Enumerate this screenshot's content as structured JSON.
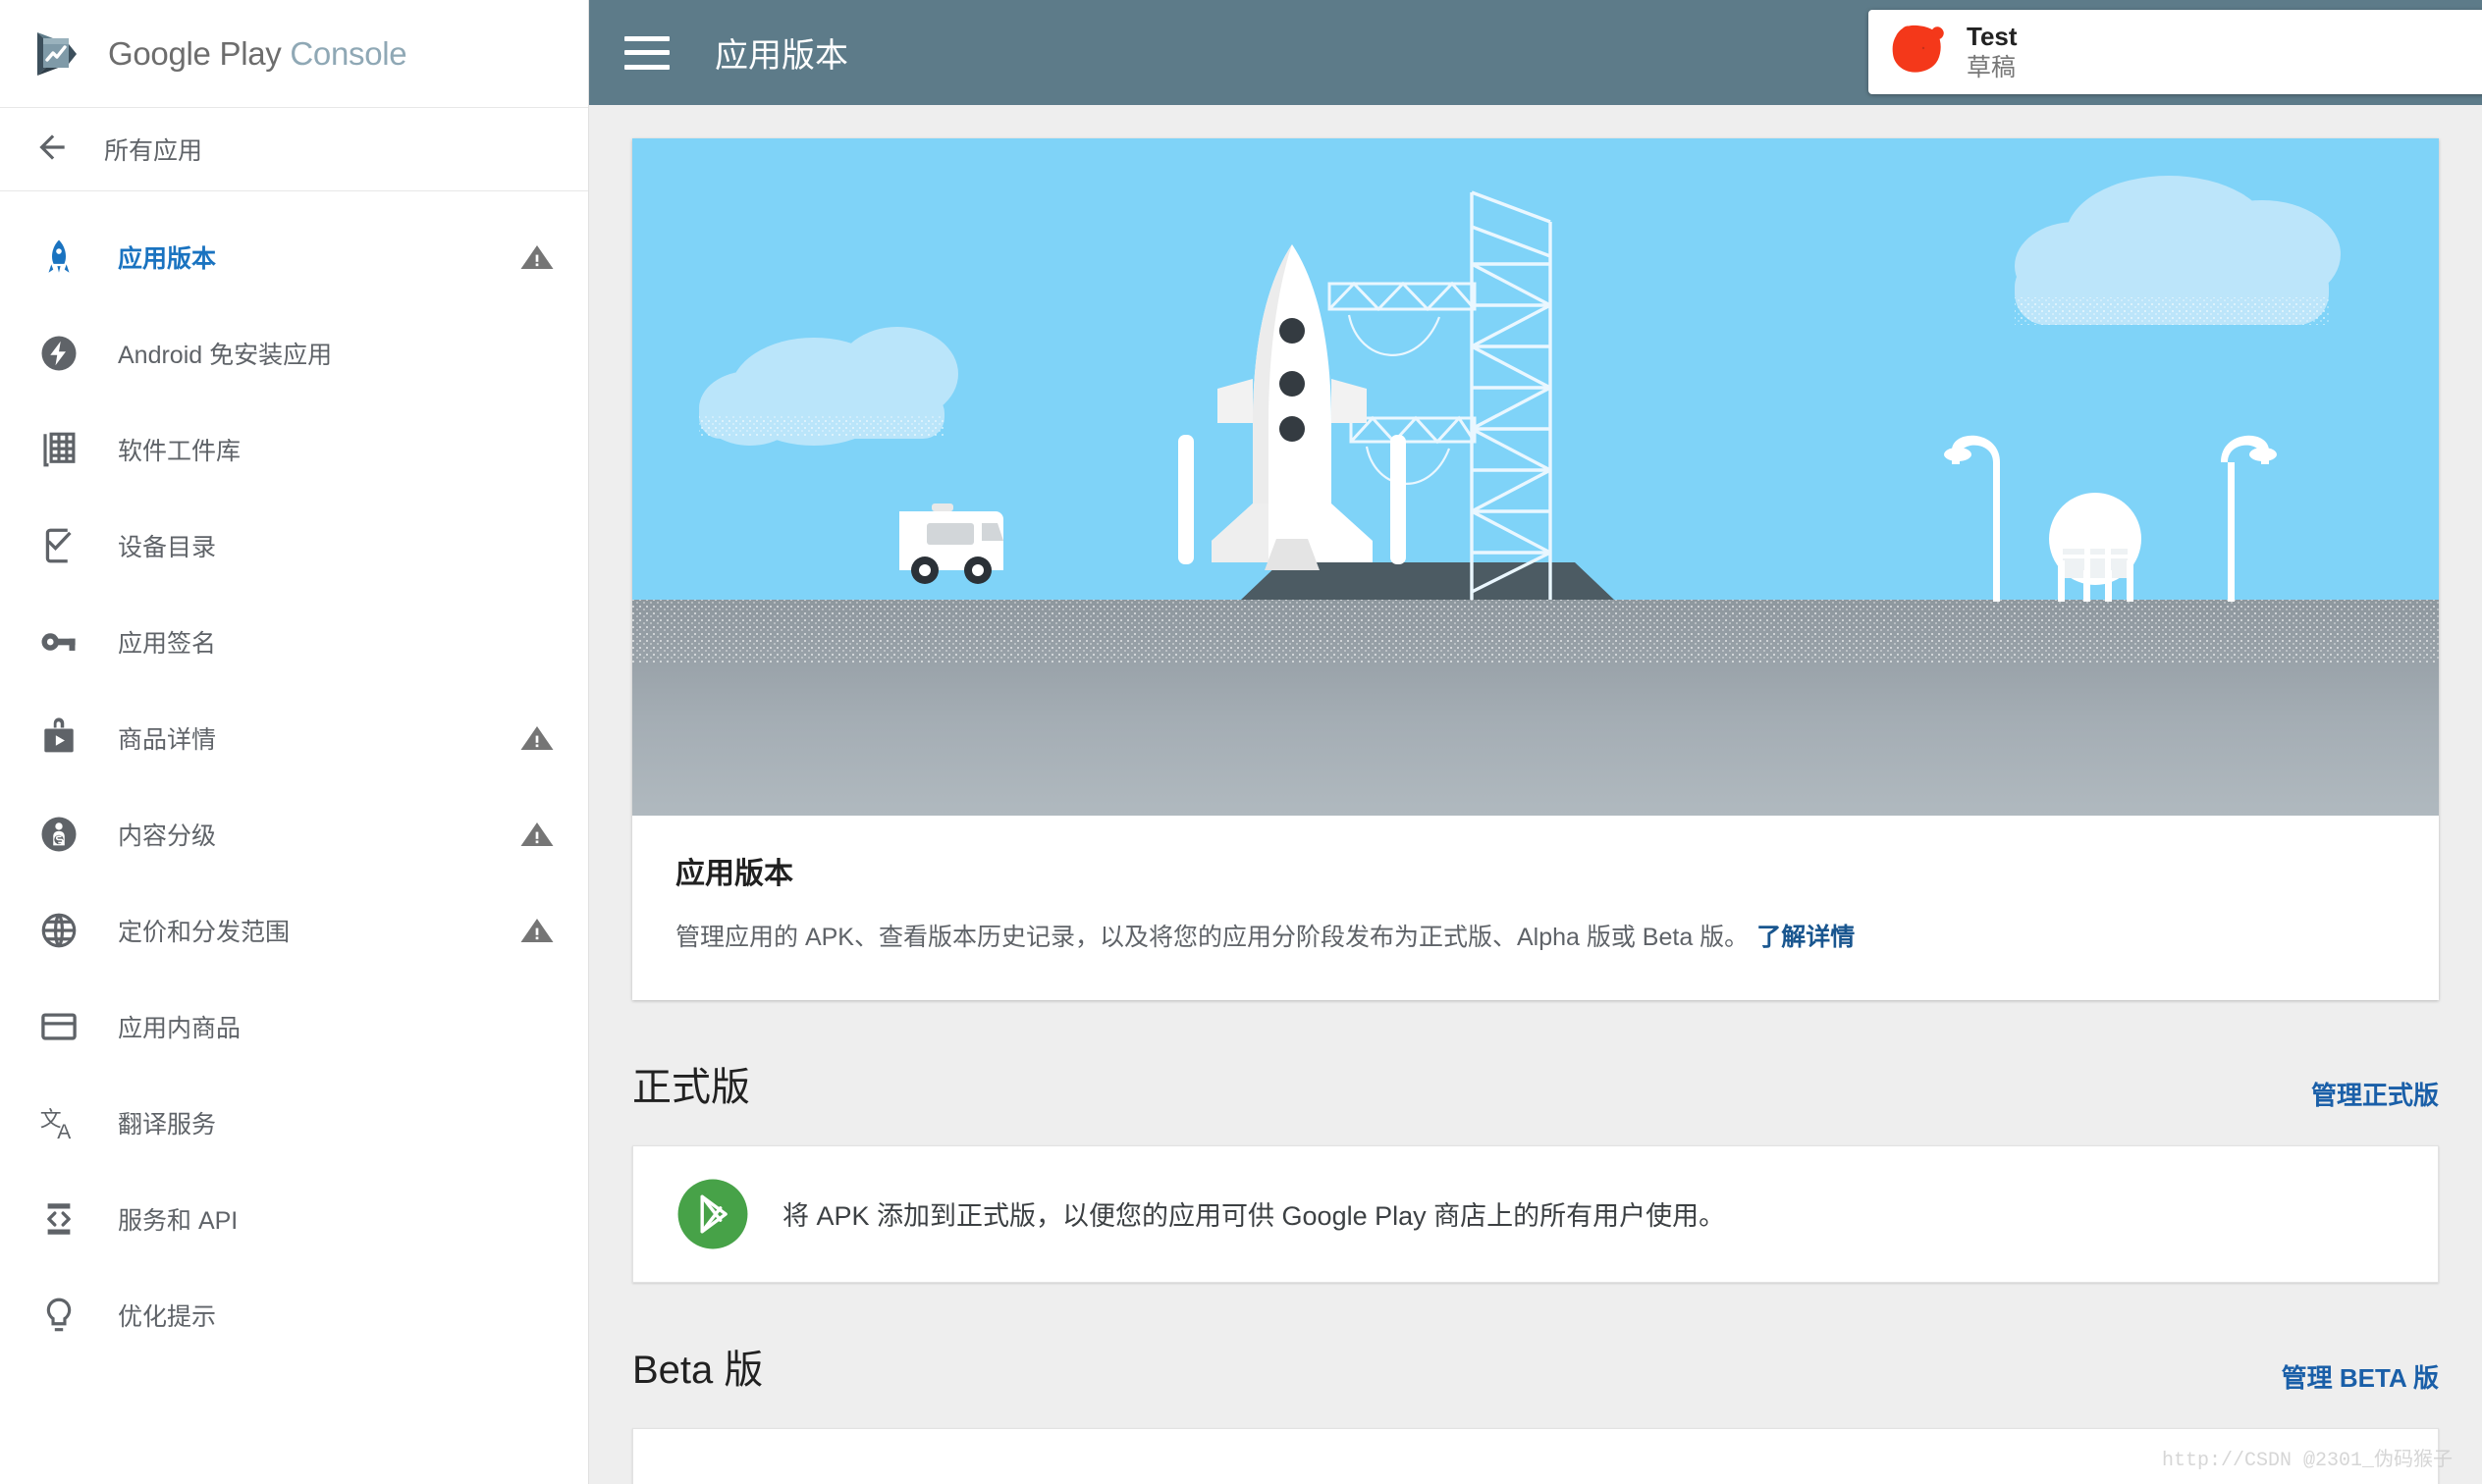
{
  "brand": {
    "word1": "Google Play",
    "word2": "Console",
    "logo_icon": "play-console-logo-icon"
  },
  "sidebar": {
    "back": {
      "label": "所有应用",
      "icon": "arrow-left-icon"
    },
    "items": [
      {
        "label": "应用版本",
        "icon": "rocket-icon",
        "active": true,
        "warning": true
      },
      {
        "label": "Android 免安装应用",
        "icon": "instant-app-icon",
        "active": false,
        "warning": false
      },
      {
        "label": "软件工件库",
        "icon": "artifact-library-icon",
        "active": false,
        "warning": false
      },
      {
        "label": "设备目录",
        "icon": "device-catalog-icon",
        "active": false,
        "warning": false
      },
      {
        "label": "应用签名",
        "icon": "key-icon",
        "active": false,
        "warning": false
      },
      {
        "label": "商品详情",
        "icon": "store-listing-icon",
        "active": false,
        "warning": true
      },
      {
        "label": "内容分级",
        "icon": "content-rating-icon",
        "active": false,
        "warning": true
      },
      {
        "label": "定价和分发范围",
        "icon": "globe-icon",
        "active": false,
        "warning": true
      },
      {
        "label": "应用内商品",
        "icon": "credit-card-icon",
        "active": false,
        "warning": false
      },
      {
        "label": "翻译服务",
        "icon": "translate-icon",
        "active": false,
        "warning": false
      },
      {
        "label": "服务和 API",
        "icon": "code-device-icon",
        "active": false,
        "warning": false
      },
      {
        "label": "优化提示",
        "icon": "lightbulb-icon",
        "active": false,
        "warning": false
      }
    ]
  },
  "topbar": {
    "menu_icon": "hamburger-menu-icon",
    "title": "应用版本",
    "app_selector": {
      "app_icon": "app-icon-redacted",
      "app_name": "Test",
      "app_state": "草稿",
      "caret_icon": "chevron-down-icon",
      "info_icon": "info-circle-icon"
    },
    "notifications_icon": "bell-icon",
    "help_icon": "help-question-icon",
    "account_icon": "android-avatar-icon"
  },
  "hero": {
    "illustration": "rocket-launch-pad-illustration",
    "heading": "应用版本",
    "description": "管理应用的 APK、查看版本历史记录，以及将您的应用分阶段发布为正式版、Alpha 版或 Beta 版。",
    "learn_more": "了解详情"
  },
  "sections": [
    {
      "title": "正式版",
      "manage_link": "管理正式版",
      "card": {
        "icon": "google-play-badge-icon",
        "text": "将 APK 添加到正式版，以便您的应用可供 Google Play 商店上的所有用户使用。"
      }
    },
    {
      "title": "Beta 版",
      "manage_link": "管理 BETA 版"
    }
  ],
  "watermark": "http://CSDN @2301_伪码猴子",
  "colors": {
    "topbar_bg": "#5d7b89",
    "accent_blue": "#1a73c0",
    "link_blue": "#1a5fa8",
    "sky": "#7fd3f8",
    "ground": "#adb6bc",
    "play_green": "#47a248",
    "app_icon_red": "#f4381a",
    "warning_gray": "#757575"
  }
}
